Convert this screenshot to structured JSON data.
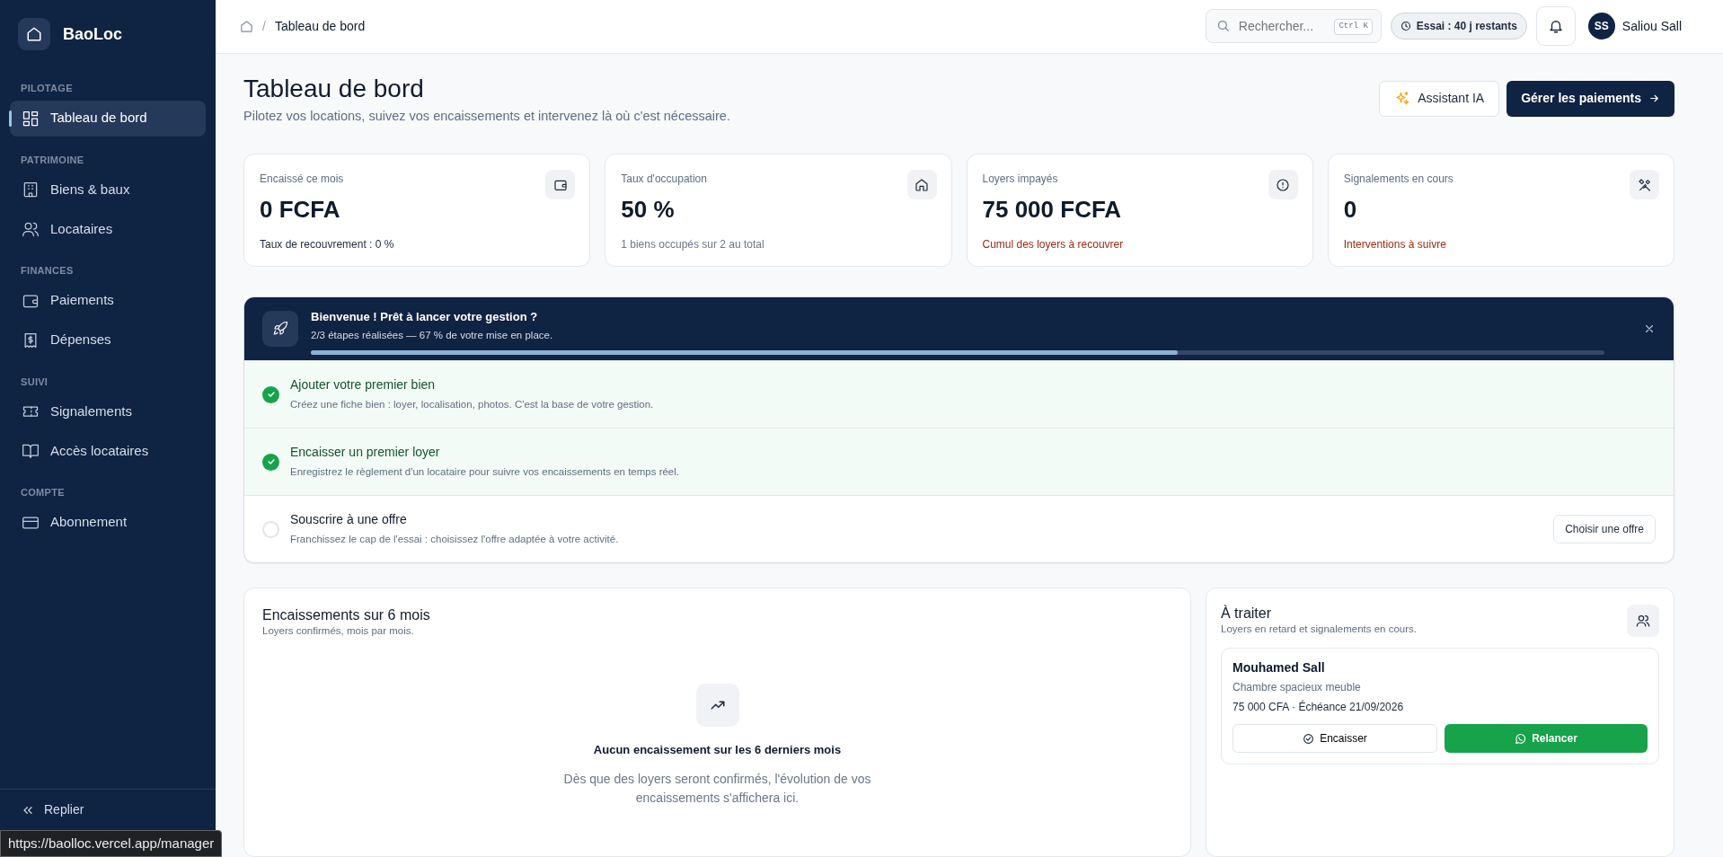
{
  "brand": {
    "name": "BaoLoc"
  },
  "sidebar": {
    "sections": [
      {
        "title": "PILOTAGE",
        "items": [
          {
            "label": "Tableau de bord",
            "selected": true
          }
        ]
      },
      {
        "title": "PATRIMOINE",
        "items": [
          {
            "label": "Biens & baux",
            "selected": false
          },
          {
            "label": "Locataires",
            "selected": false
          }
        ]
      },
      {
        "title": "FINANCES",
        "items": [
          {
            "label": "Paiements",
            "selected": false
          },
          {
            "label": "Dépenses",
            "selected": false
          }
        ]
      },
      {
        "title": "SUIVI",
        "items": [
          {
            "label": "Signalements",
            "selected": false
          },
          {
            "label": "Accès locataires",
            "selected": false
          }
        ]
      },
      {
        "title": "COMPTE",
        "items": [
          {
            "label": "Abonnement",
            "selected": false
          }
        ]
      }
    ],
    "footer": {
      "label": "Replier"
    }
  },
  "header": {
    "breadcrumb_separator": "/",
    "breadcrumb": "Tableau de bord",
    "search": {
      "placeholder": "Rechercher...",
      "shortcut": "Ctrl K"
    },
    "trial": "Essai : 40 j restants",
    "user": {
      "initials": "SS",
      "name": "Saliou Sall"
    }
  },
  "page": {
    "title": "Tableau de bord",
    "subtitle": "Pilotez vos locations, suivez vos encaissements et intervenez là où c'est nécessaire.",
    "buttons": [
      {
        "label": "Assistant IA",
        "kind": "secondary"
      },
      {
        "label": "Gérer les paiements",
        "kind": "primary"
      }
    ]
  },
  "stats": [
    {
      "label": "Encaissé ce mois",
      "value": "0 FCFA",
      "note": "Taux de recouvrement : 0 %",
      "kind": "neutral"
    },
    {
      "label": "Taux d'occupation",
      "value": "50 %",
      "note": "1 biens occupés sur 2 au total",
      "kind": "muted"
    },
    {
      "label": "Loyers impayés",
      "value": "75 000 FCFA",
      "note": "Cumul des loyers à recouvrer",
      "kind": "alert"
    },
    {
      "label": "Signalements en cours",
      "value": "0",
      "note": "Interventions à suivre",
      "kind": "alert"
    }
  ],
  "onboarding": {
    "title": "Bienvenue ! Prêt à lancer votre gestion ?",
    "progress_text": "2/3 étapes réalisées — 67 % de votre mise en place.",
    "level": 0.67,
    "steps": [
      {
        "title": "Ajouter votre premier bien",
        "text": "Créez une fiche bien : loyer, localisation, photos. C'est la base de votre gestion.",
        "checked": true
      },
      {
        "title": "Encaisser un premier loyer",
        "text": "Enregistrez le règlement d'un locataire pour suivre vos encaissements en temps réel.",
        "checked": true
      },
      {
        "title": "Souscrire à une offre",
        "text": "Franchissez le cap de l'essai : choisissez l'offre adaptée à votre activité.",
        "checked": false,
        "action": "Choisir une offre"
      }
    ]
  },
  "revenue": {
    "title": "Encaissements sur 6 mois",
    "subtitle": "Loyers confirmés, mois par mois.",
    "empty_title": "Aucun encaissement sur les 6 derniers mois",
    "empty_text": "Dès que des loyers seront confirmés, l'évolution de vos encaissements s'affichera ici."
  },
  "todo": {
    "title": "À traiter",
    "subtitle": "Loyers en retard et signalements en cours.",
    "items": [
      {
        "name": "Mouhamed Sall",
        "property": "Chambre spacieux meuble",
        "detail": "75 000 CFA · Échéance 21/09/2026",
        "actions": [
          {
            "label": "Encaisser",
            "kind": "outline"
          },
          {
            "label": "Relancer",
            "kind": "whatsapp"
          }
        ]
      }
    ]
  },
  "status_bar": {
    "url": "https://baolloc.vercel.app/manager"
  }
}
